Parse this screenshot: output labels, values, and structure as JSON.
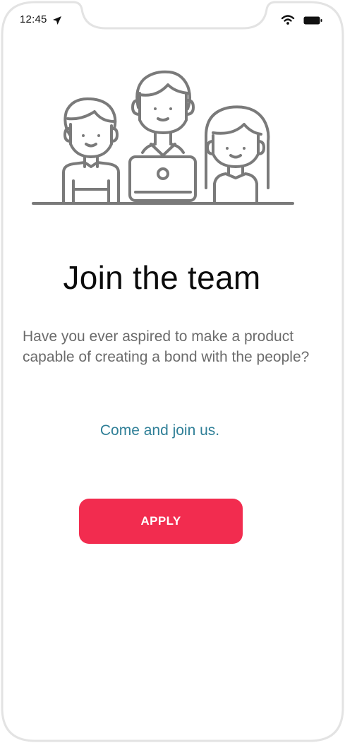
{
  "status_bar": {
    "time": "12:45",
    "icons": [
      "location-arrow-icon",
      "wifi-icon",
      "battery-icon"
    ]
  },
  "illustration": {
    "icon": "team-illustration-icon",
    "stroke_color": "#7a7a7a"
  },
  "content": {
    "title": "Join the team",
    "body": "Have you ever aspired to make a product capable of creating a bond with the people?",
    "link": "Come and join us."
  },
  "actions": {
    "apply_label": "APPLY"
  },
  "colors": {
    "accent": "#f22c4f",
    "link": "#2f7f97",
    "body_text": "#6b6b6b",
    "frame": "#e6e6e6"
  }
}
